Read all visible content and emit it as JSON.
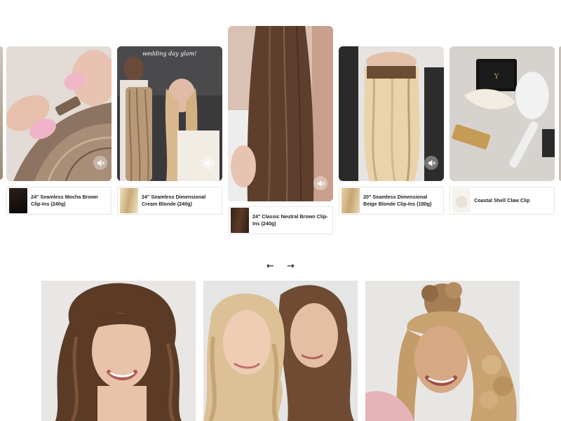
{
  "carousel": {
    "slides": [
      {
        "product": "24\" Seamless Mocha Brown Clip-Ins (240g)",
        "overlay_text": "",
        "icon": "speaker-muted-icon"
      },
      {
        "product": "24\" Seamless Dimensional Cream Blonde (240g)",
        "overlay_text": "wedding day glam!",
        "icon": "speaker-muted-icon"
      },
      {
        "product": "24\" Classic Neutral Brown Clip-Ins (240g)",
        "overlay_text": "",
        "icon": "speaker-muted-icon"
      },
      {
        "product": "20\" Seamless Dimensional Beige Blonde Clip-Ins (180g)",
        "overlay_text": "",
        "icon": "speaker-muted-icon"
      },
      {
        "product": "Coastal Shell Claw Clip",
        "overlay_text": "",
        "icon": ""
      }
    ],
    "prev_arrow": "←",
    "next_arrow": "→"
  },
  "models": [
    {
      "name": "model-brunette-waves"
    },
    {
      "name": "model-blonde-brunette-duo"
    },
    {
      "name": "model-curly-blonde-ponytail"
    }
  ]
}
